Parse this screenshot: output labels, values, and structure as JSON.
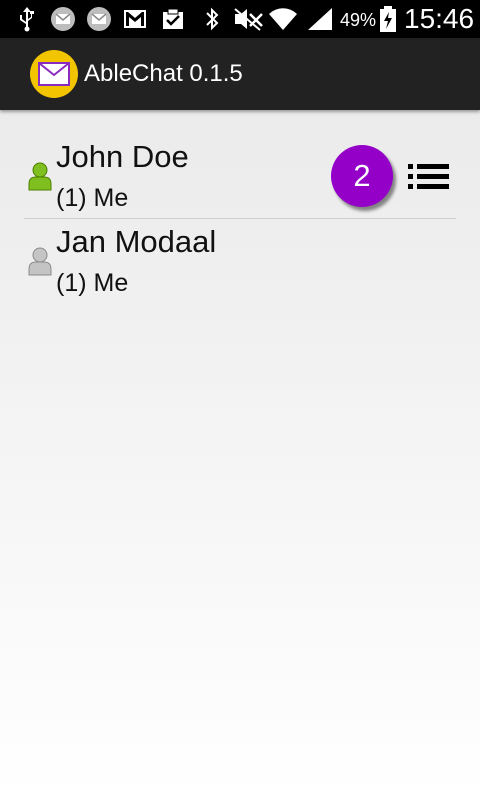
{
  "status_bar": {
    "battery": "49%",
    "time": "15:46",
    "icons": [
      "usb-icon",
      "mail-icon",
      "mail-icon",
      "gmail-icon",
      "clipboard-check-icon",
      "bluetooth-icon",
      "mute-icon",
      "wifi-icon",
      "signal-icon",
      "battery-icon"
    ]
  },
  "app": {
    "title": "AbleChat 0.1.5",
    "logo": "envelope-logo"
  },
  "colors": {
    "badge": "#9400c8",
    "online": "#7fbf1f",
    "offline": "#b8b8b8",
    "logo_bg": "#f2c500"
  },
  "contacts": [
    {
      "name": "John Doe",
      "subtitle": "(1) Me",
      "status": "online",
      "unread": "2"
    },
    {
      "name": "Jan Modaal",
      "subtitle": "(1) Me",
      "status": "offline"
    }
  ]
}
